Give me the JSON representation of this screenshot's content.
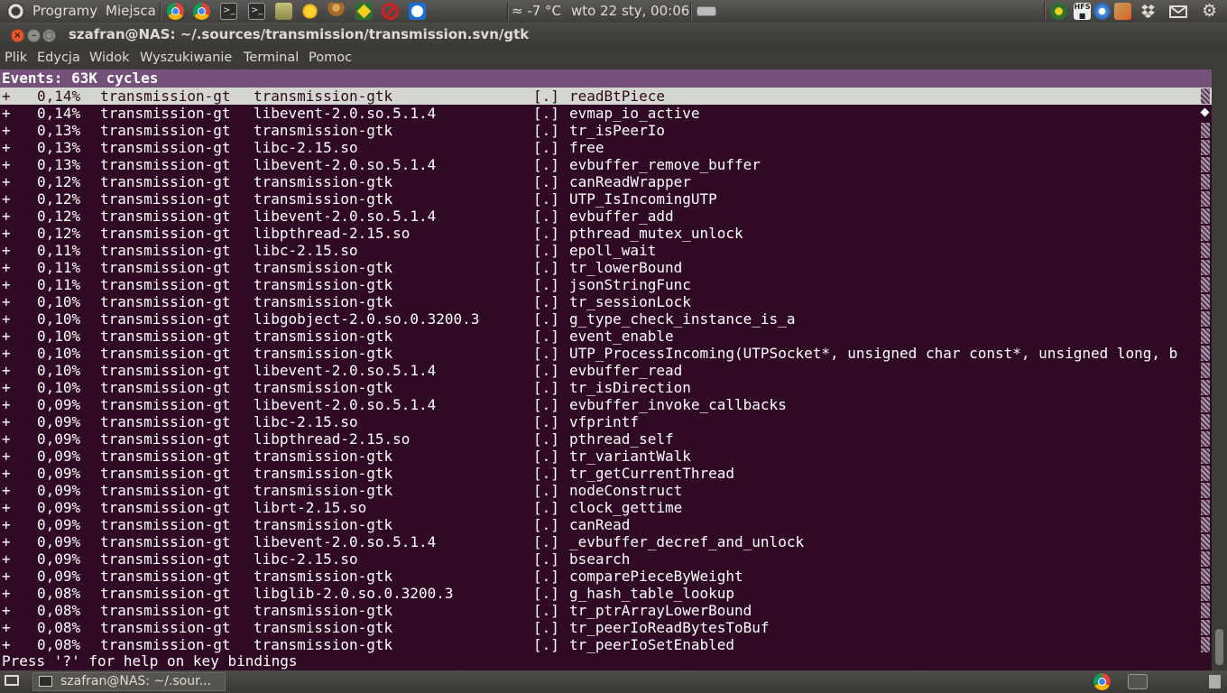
{
  "top_panel": {
    "programs": "Programy",
    "places": "Miejsca",
    "weather": "≈ -7 °C",
    "clock": "wto 22 sty, 00:06",
    "icons": [
      "ubuntu-logo-icon",
      "chrome-icon",
      "chrome-icon",
      "terminal-icon",
      "terminal-icon",
      "file-manager-icon",
      "sun-icon",
      "monk-icon",
      "network-icon",
      "stop-icon",
      "teamviewer-icon",
      "keyboard-icon",
      "hfs-icon",
      "network-icon",
      "update-icon",
      "dropbox-icon",
      "mail-icon",
      "gear-icon"
    ]
  },
  "window": {
    "title": "szafran@NAS: ~/.sources/transmission/transmission.svn/gtk",
    "menu": [
      "Plik",
      "Edycja",
      "Widok",
      "Wyszukiwanie",
      "Terminal",
      "Pomoc"
    ]
  },
  "terminal": {
    "header": "Events: 63K cycles",
    "rows": [
      [
        "+",
        "0,14%",
        "transmission-gt",
        "transmission-gtk",
        "[.]",
        "readBtPiece"
      ],
      [
        "+",
        "0,14%",
        "transmission-gt",
        "libevent-2.0.so.5.1.4",
        "[.]",
        "evmap_io_active"
      ],
      [
        "+",
        "0,13%",
        "transmission-gt",
        "transmission-gtk",
        "[.]",
        "tr_isPeerIo"
      ],
      [
        "+",
        "0,13%",
        "transmission-gt",
        "libc-2.15.so",
        "[.]",
        "free"
      ],
      [
        "+",
        "0,13%",
        "transmission-gt",
        "libevent-2.0.so.5.1.4",
        "[.]",
        "evbuffer_remove_buffer"
      ],
      [
        "+",
        "0,12%",
        "transmission-gt",
        "transmission-gtk",
        "[.]",
        "canReadWrapper"
      ],
      [
        "+",
        "0,12%",
        "transmission-gt",
        "transmission-gtk",
        "[.]",
        "UTP_IsIncomingUTP"
      ],
      [
        "+",
        "0,12%",
        "transmission-gt",
        "libevent-2.0.so.5.1.4",
        "[.]",
        "evbuffer_add"
      ],
      [
        "+",
        "0,12%",
        "transmission-gt",
        "libpthread-2.15.so",
        "[.]",
        "pthread_mutex_unlock"
      ],
      [
        "+",
        "0,11%",
        "transmission-gt",
        "libc-2.15.so",
        "[.]",
        "epoll_wait"
      ],
      [
        "+",
        "0,11%",
        "transmission-gt",
        "transmission-gtk",
        "[.]",
        "tr_lowerBound"
      ],
      [
        "+",
        "0,11%",
        "transmission-gt",
        "transmission-gtk",
        "[.]",
        "jsonStringFunc"
      ],
      [
        "+",
        "0,10%",
        "transmission-gt",
        "transmission-gtk",
        "[.]",
        "tr_sessionLock"
      ],
      [
        "+",
        "0,10%",
        "transmission-gt",
        "libgobject-2.0.so.0.3200.3",
        "[.]",
        "g_type_check_instance_is_a"
      ],
      [
        "+",
        "0,10%",
        "transmission-gt",
        "transmission-gtk",
        "[.]",
        "event_enable"
      ],
      [
        "+",
        "0,10%",
        "transmission-gt",
        "transmission-gtk",
        "[.]",
        "UTP_ProcessIncoming(UTPSocket*, unsigned char const*, unsigned long, b"
      ],
      [
        "+",
        "0,10%",
        "transmission-gt",
        "libevent-2.0.so.5.1.4",
        "[.]",
        "evbuffer_read"
      ],
      [
        "+",
        "0,10%",
        "transmission-gt",
        "transmission-gtk",
        "[.]",
        "tr_isDirection"
      ],
      [
        "+",
        "0,09%",
        "transmission-gt",
        "libevent-2.0.so.5.1.4",
        "[.]",
        "evbuffer_invoke_callbacks"
      ],
      [
        "+",
        "0,09%",
        "transmission-gt",
        "libc-2.15.so",
        "[.]",
        "vfprintf"
      ],
      [
        "+",
        "0,09%",
        "transmission-gt",
        "libpthread-2.15.so",
        "[.]",
        "pthread_self"
      ],
      [
        "+",
        "0,09%",
        "transmission-gt",
        "transmission-gtk",
        "[.]",
        "tr_variantWalk"
      ],
      [
        "+",
        "0,09%",
        "transmission-gt",
        "transmission-gtk",
        "[.]",
        "tr_getCurrentThread"
      ],
      [
        "+",
        "0,09%",
        "transmission-gt",
        "transmission-gtk",
        "[.]",
        "nodeConstruct"
      ],
      [
        "+",
        "0,09%",
        "transmission-gt",
        "librt-2.15.so",
        "[.]",
        "clock_gettime"
      ],
      [
        "+",
        "0,09%",
        "transmission-gt",
        "transmission-gtk",
        "[.]",
        "canRead"
      ],
      [
        "+",
        "0,09%",
        "transmission-gt",
        "libevent-2.0.so.5.1.4",
        "[.]",
        "_evbuffer_decref_and_unlock"
      ],
      [
        "+",
        "0,09%",
        "transmission-gt",
        "libc-2.15.so",
        "[.]",
        "bsearch"
      ],
      [
        "+",
        "0,09%",
        "transmission-gt",
        "transmission-gtk",
        "[.]",
        "comparePieceByWeight"
      ],
      [
        "+",
        "0,08%",
        "transmission-gt",
        "libglib-2.0.so.0.3200.3",
        "[.]",
        "g_hash_table_lookup"
      ],
      [
        "+",
        "0,08%",
        "transmission-gt",
        "transmission-gtk",
        "[.]",
        "tr_ptrArrayLowerBound"
      ],
      [
        "+",
        "0,08%",
        "transmission-gt",
        "transmission-gtk",
        "[.]",
        "tr_peerIoReadBytesToBuf"
      ],
      [
        "+",
        "0,08%",
        "transmission-gt",
        "transmission-gtk",
        "[.]",
        "tr_peerIoSetEnabled"
      ]
    ],
    "status": "Press '?' for help on key bindings"
  },
  "taskbar": {
    "task_label": "szafran@NAS: ~/.sour..."
  }
}
